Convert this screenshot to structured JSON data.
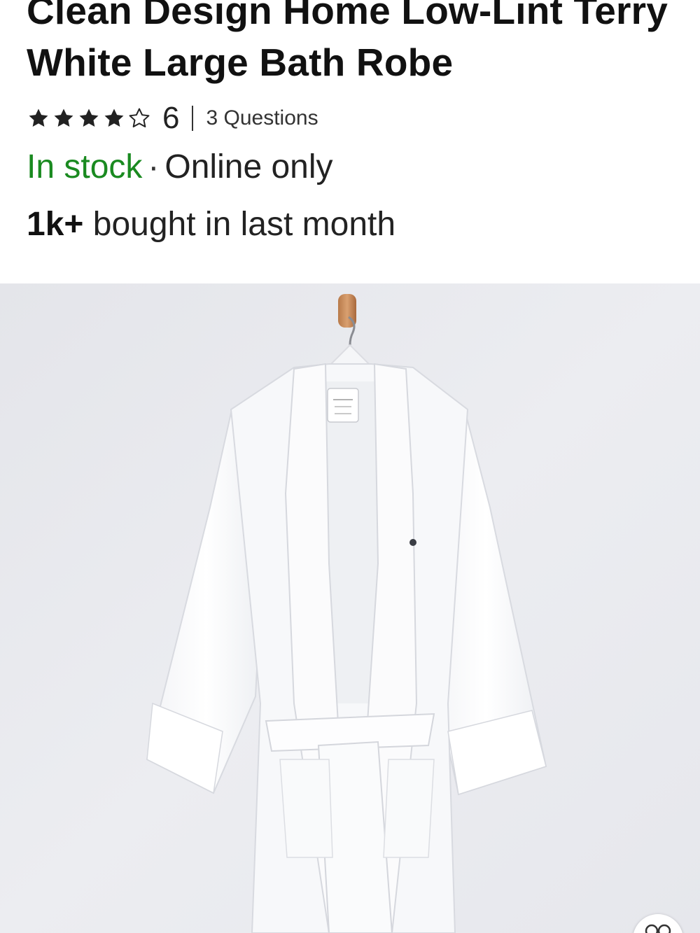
{
  "product": {
    "title": "Clean Design Home Low-Lint Terry White Large Bath Robe",
    "rating_value": 4,
    "rating_max": 5,
    "rating_count": "6",
    "questions": "3 Questions"
  },
  "availability": {
    "stock_status": "In stock",
    "separator": "·",
    "channel": "Online only",
    "stock_color": "#1a8a20"
  },
  "social_proof": {
    "count": "1k+",
    "text": "bought in last month"
  },
  "image": {
    "description_icon": "bath-robe-photo"
  },
  "zoom_button": {
    "icon": "glasses-icon"
  }
}
